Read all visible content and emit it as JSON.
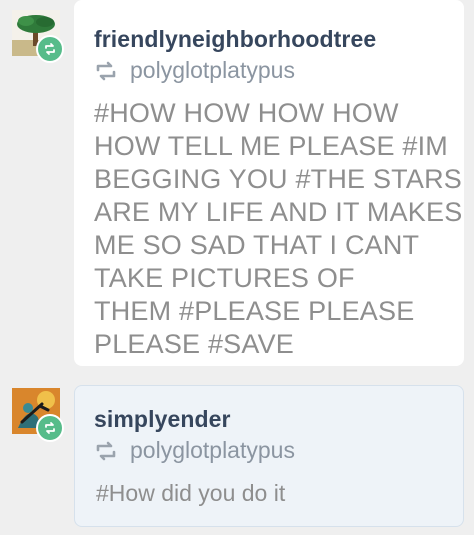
{
  "colors": {
    "background": "#efefef",
    "card": "#ffffff",
    "card_highlight": "#eef3f8",
    "username": "#36465d",
    "source": "#8b95a1",
    "tags": "#8e8e8e",
    "reblog_badge": "#56bc8a"
  },
  "posts": [
    {
      "username": "friendlyneighborhoodtree",
      "reblog_icon": "reblog-icon",
      "source": "polyglotplatypus",
      "avatar_icon": "tree-avatar-icon",
      "tag_lines": [
        "#HOW HOW HOW HOW",
        "HOW TELL ME PLEASE  #IM",
        "BEGGING YOU  #THE STARS",
        "ARE MY LIFE AND IT MAKES",
        "ME SO SAD THAT I CANT",
        "TAKE PICTURES OF",
        "THEM  #PLEASE PLEASE",
        "PLEASE  #SAVE"
      ]
    },
    {
      "username": "simplyender",
      "reblog_icon": "reblog-icon",
      "source": "polyglotplatypus",
      "avatar_icon": "ender-avatar-icon",
      "tags": "#How did you do it"
    }
  ]
}
